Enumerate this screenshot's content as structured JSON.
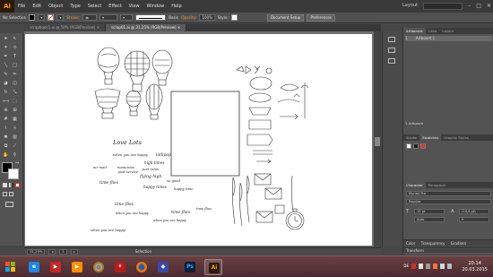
{
  "menubar": {
    "logo": "Ai",
    "items": [
      "File",
      "Edit",
      "Object",
      "Type",
      "Select",
      "Effect",
      "View",
      "Window",
      "Help"
    ],
    "workspace": "Layout"
  },
  "control_bar": {
    "selection_label": "No Selection",
    "stroke_label": "Stroke:",
    "brush_value": "Basic",
    "opacity_label": "Opacity:",
    "opacity_value": "100%",
    "style_label": "Style:",
    "doc_setup_button": "Document Setup",
    "preferences_button": "Preferences",
    "fill_color": "#ffffff",
    "stroke_color": "#ff3b30"
  },
  "document_tabs": [
    {
      "label": "scrapbook1.ai @ 50% (RGB/Preview)",
      "active": false
    },
    {
      "label": "scrap01.ai @ 31,25% (RGB/Preview)",
      "active": true
    }
  ],
  "status_bar": {
    "zoom": "31,25%",
    "artboard_nav": "1",
    "tool": "Selection"
  },
  "artboard_text": {
    "love_lots": "Love Lots",
    "when_you_are_happy_1": "when you are happy",
    "lollipop": "lollipop",
    "high_times": "high times",
    "air_mail": "air mail",
    "memories": "memories",
    "just_relax": "just relax",
    "post_service": "post service",
    "flying_high": "flying high",
    "time_flies_1": "time flies",
    "happy_times": "happy times",
    "so_good": "so good",
    "happy_time": "happy time",
    "time_flies_2": "time flies",
    "when_you_are_happy_2": "when you are happy",
    "time_flies_3": "time flies",
    "time_flies_4": "time flies",
    "when_you_are_happy_3": "when you are happy",
    "when_you_are_happy_4": "when you are happy"
  },
  "panels": {
    "artboards": {
      "tabs": [
        "Artboards",
        "Links",
        "Layers"
      ],
      "row_index": "1",
      "row_name": "Artboard 1",
      "footer": "1 Artboard"
    },
    "swatches": {
      "tabs": [
        "Stroke",
        "Swatches",
        "Graphic Styles"
      ]
    },
    "character": {
      "tabs": [
        "Character",
        "Paragraph"
      ],
      "font": "Myriad Pro",
      "style": "Regular",
      "size": "12 pt",
      "leading": "(14,4 pt)",
      "tracking": "0",
      "kerning": "Auto"
    },
    "color_title": "Color",
    "color_tabs": [
      "Color",
      "Transparency",
      "Gradient"
    ],
    "transform_title": "Transform"
  },
  "taskbar": {
    "apps": [
      "windows-start",
      "ie",
      "media-center",
      "media-player",
      "chrome",
      "acrobat",
      "firefox",
      "photoshop",
      "illustrator"
    ],
    "active_app": "illustrator",
    "time": "20:14",
    "date": "20.03.2015",
    "lang": "DE"
  }
}
